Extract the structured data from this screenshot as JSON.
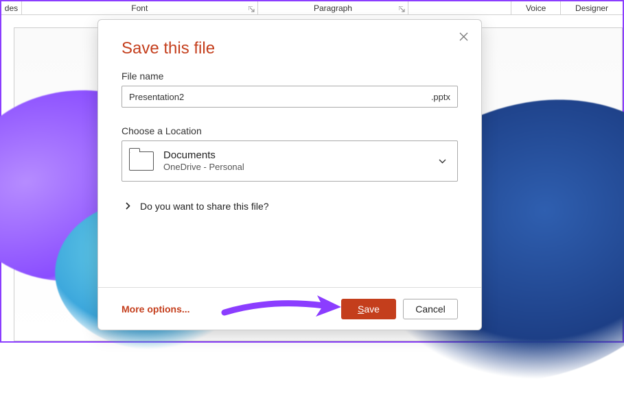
{
  "ribbon": {
    "slides_label": "des",
    "font_label": "Font",
    "paragraph_label": "Paragraph",
    "voice_label": "Voice",
    "designer_label": "Designer"
  },
  "dialog": {
    "title": "Save this file",
    "filename_label": "File name",
    "filename_value": "Presentation2",
    "file_extension": ".pptx",
    "location_label": "Choose a Location",
    "location_name": "Documents",
    "location_sub": "OneDrive - Personal",
    "share_prompt": "Do you want to share this file?",
    "more_options": "More options...",
    "save_label": "Save",
    "save_underline_char": "S",
    "save_rest": "ave",
    "cancel_label": "Cancel"
  }
}
